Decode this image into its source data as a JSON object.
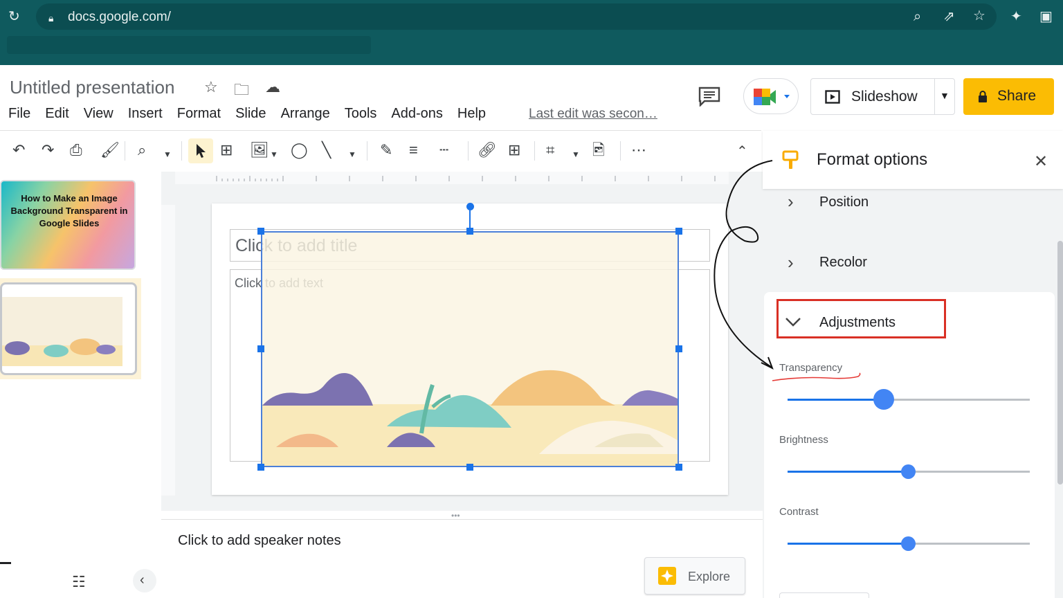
{
  "browser": {
    "url": "docs.google.com/",
    "theme_color": "#0f5a5e"
  },
  "app": {
    "doc_title": "Untitled presentation",
    "last_edit": "Last edit was secon…",
    "menu": [
      "File",
      "Edit",
      "View",
      "Insert",
      "Format",
      "Slide",
      "Arrange",
      "Tools",
      "Add-ons",
      "Help"
    ],
    "slideshow_label": "Slideshow",
    "share_label": "Share",
    "share_color": "#fbbc04"
  },
  "filmstrip": {
    "slide1_text": "How to Make an Image Background Transparent in Google Slides"
  },
  "slide": {
    "title_placeholder": "Click to add title",
    "body_placeholder": "Click to add text"
  },
  "notes": {
    "placeholder": "Click to add speaker notes",
    "explore_label": "Explore"
  },
  "panel": {
    "title": "Format options",
    "sections": {
      "position": "Position",
      "recolor": "Recolor",
      "adjustments": "Adjustments"
    },
    "sliders": [
      {
        "label": "Transparency",
        "value": 0.4
      },
      {
        "label": "Brightness",
        "value": 0.5
      },
      {
        "label": "Contrast",
        "value": 0.5
      }
    ],
    "highlight_color": "#d93025",
    "accent_color": "#1a73e8"
  },
  "icons": [
    "reload-icon",
    "lock-icon",
    "zoom-icon",
    "share-page-icon",
    "star-icon",
    "extensions-icon",
    "sidebar-icon",
    "move-folder-icon",
    "cloud-icon",
    "comments-icon",
    "meet-icon",
    "present-icon",
    "lock-share-icon",
    "undo-icon",
    "redo-icon",
    "print-icon",
    "paint-format-icon",
    "zoom-tool-icon",
    "select-icon",
    "textbox-icon",
    "image-icon",
    "shape-icon",
    "line-icon",
    "pen-icon",
    "border-weight-icon",
    "border-dash-icon",
    "link-icon",
    "comment-add-icon",
    "crop-icon",
    "replace-image-icon",
    "more-icon",
    "format-paint-icon",
    "close-icon",
    "explore-icon",
    "grid-icon"
  ]
}
